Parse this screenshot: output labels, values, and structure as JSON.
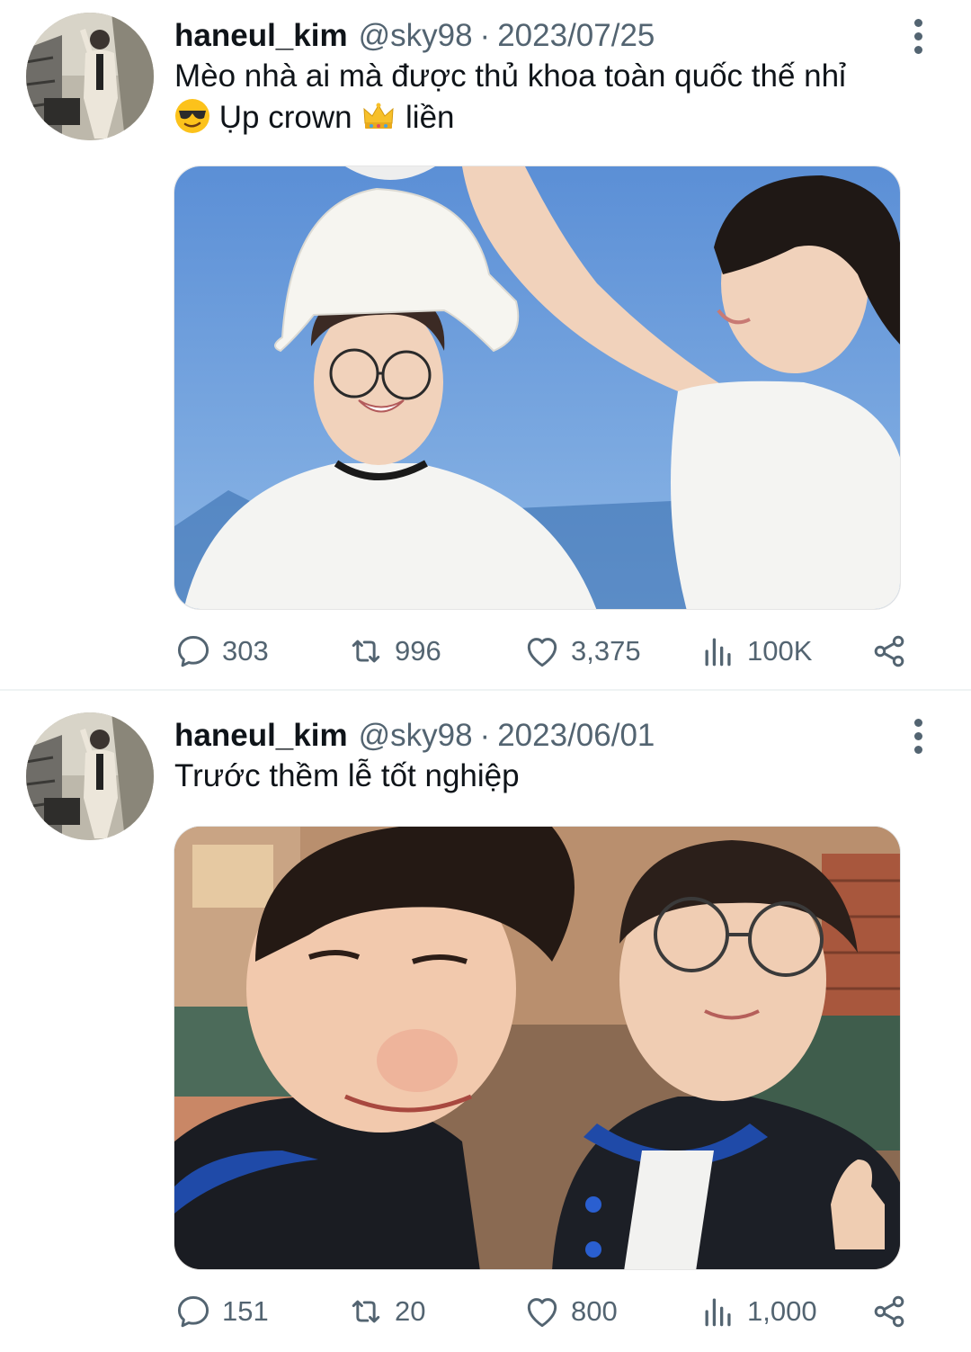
{
  "tweets": [
    {
      "display_name": "haneul_kim",
      "handle": "@sky98",
      "separator": "·",
      "date": "2023/07/25",
      "text_line1": "Mèo nhà ai mà được thủ khoa toàn quốc thế nhỉ",
      "text_line2_part1": "Ụp crown",
      "text_line2_part2": "liền",
      "emojis": [
        "smiling-face-with-sunglasses",
        "crown"
      ],
      "stats": {
        "replies": "303",
        "retweets": "996",
        "likes": "3,375",
        "views": "100K"
      }
    },
    {
      "display_name": "haneul_kim",
      "handle": "@sky98",
      "separator": "·",
      "date": "2023/06/01",
      "text_line1": "Trước thềm lễ tốt nghiệp",
      "stats": {
        "replies": "151",
        "retweets": "20",
        "likes": "800",
        "views": "1,000"
      }
    }
  ],
  "icons": [
    "comment-icon",
    "retweet-icon",
    "heart-icon",
    "views-chart-icon",
    "share-icon",
    "more-options-icon"
  ],
  "colors": {
    "text": "#0f1419",
    "secondary": "#536471",
    "divider": "#eff3f4"
  }
}
